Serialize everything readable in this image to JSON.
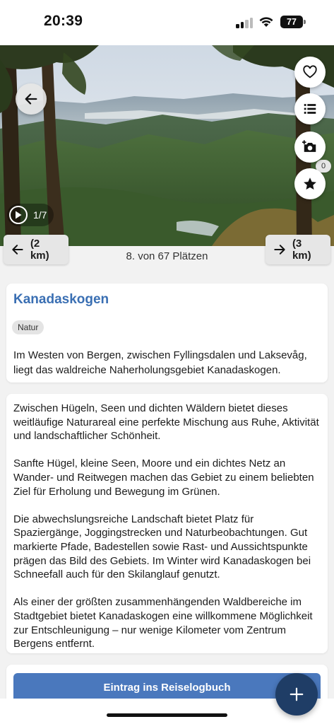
{
  "status_bar": {
    "time": "20:39",
    "battery": "77"
  },
  "hero": {
    "gallery_counter": "1/7",
    "icons": {
      "back": "arrow-left-icon",
      "favorite": "heart-icon",
      "list": "list-icon",
      "list_count": "0",
      "add_photo": "camera-plus-icon",
      "rate": "star-icon",
      "gallery": "play-icon"
    }
  },
  "place_nav": {
    "prev_label": "(2 km)",
    "next_label": "(3 km)",
    "counter": "8. von 67 Plätzen"
  },
  "place": {
    "title": "Kanadaskogen",
    "tag": "Natur",
    "intro": "Im Westen von Bergen, zwischen Fyllingsdalen und Laksevåg, liegt das waldreiche Naherholungsgebiet Kanadaskogen."
  },
  "description": [
    "Zwischen Hügeln, Seen und dichten Wäldern bietet dieses weitläufige Naturareal eine perfekte Mischung aus Ruhe, Aktivität und landschaftlicher Schönheit.",
    "Sanfte Hügel, kleine Seen, Moore und ein dichtes Netz an Wander- und Reitwegen machen das Gebiet zu einem beliebten Ziel für Erholung und Bewegung im Grünen.",
    "Die abwechslungsreiche Landschaft bietet Platz für Spaziergänge, Joggingstrecken und Naturbeobachtungen. Gut markierte Pfade, Badestellen sowie Rast- und Aussichtspunkte prägen das Bild des Gebiets. Im Winter wird Kanadaskogen bei Schneefall auch für den Skilanglauf genutzt.",
    "Als einer der größten zusammenhängenden Waldbereiche im Stadtgebiet bietet Kanadaskogen eine willkommene Möglichkeit zur Entschleunigung – nur wenige Kilometer vom Zentrum Bergens entfernt."
  ],
  "actions": {
    "logbook_button": "Eintrag ins Reiselogbuch",
    "fab_icon": "plus-icon"
  },
  "colors": {
    "accent": "#3a6fb3",
    "button": "#4a78bd",
    "fab": "#1f3d66"
  }
}
